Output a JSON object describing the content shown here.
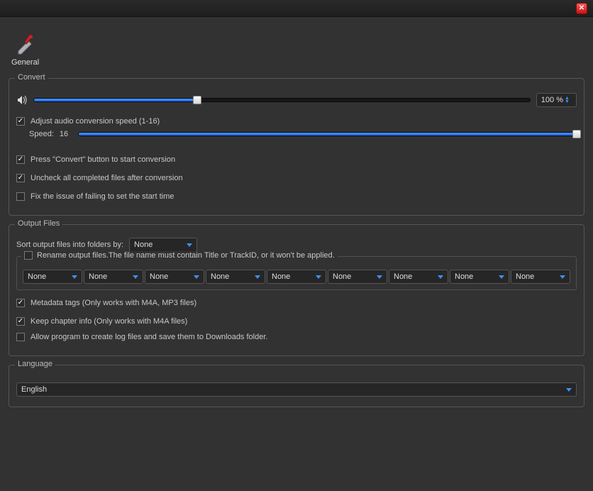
{
  "titlebar": {
    "close_label": "✕"
  },
  "tabs": {
    "general": "General"
  },
  "convert": {
    "legend": "Convert",
    "volume_percent": "100 %",
    "volume_fill": 33,
    "adjust_speed_label": "Adjust audio conversion speed (1-16)",
    "adjust_speed_checked": true,
    "speed_label": "Speed:",
    "speed_value": "16",
    "speed_fill": 100,
    "press_convert_label": "Press \"Convert\" button to start conversion",
    "press_convert_checked": true,
    "uncheck_completed_label": "Uncheck all completed files after conversion",
    "uncheck_completed_checked": true,
    "fix_start_label": "Fix the issue of failing to set the start time",
    "fix_start_checked": false
  },
  "output": {
    "legend": "Output Files",
    "sort_label": "Sort output files into folders by:",
    "sort_value": "None",
    "rename_label": "Rename output files.The file name must contain Title or TrackID, or it won't be applied.",
    "rename_checked": false,
    "name_parts": [
      "None",
      "None",
      "None",
      "None",
      "None",
      "None",
      "None",
      "None",
      "None"
    ],
    "metadata_label": "Metadata tags (Only works with M4A, MP3 files)",
    "metadata_checked": true,
    "chapter_label": "Keep chapter info (Only works with M4A files)",
    "chapter_checked": true,
    "log_label": "Allow program to create log files and save them to Downloads folder.",
    "log_checked": false
  },
  "language": {
    "legend": "Language",
    "value": "English"
  }
}
